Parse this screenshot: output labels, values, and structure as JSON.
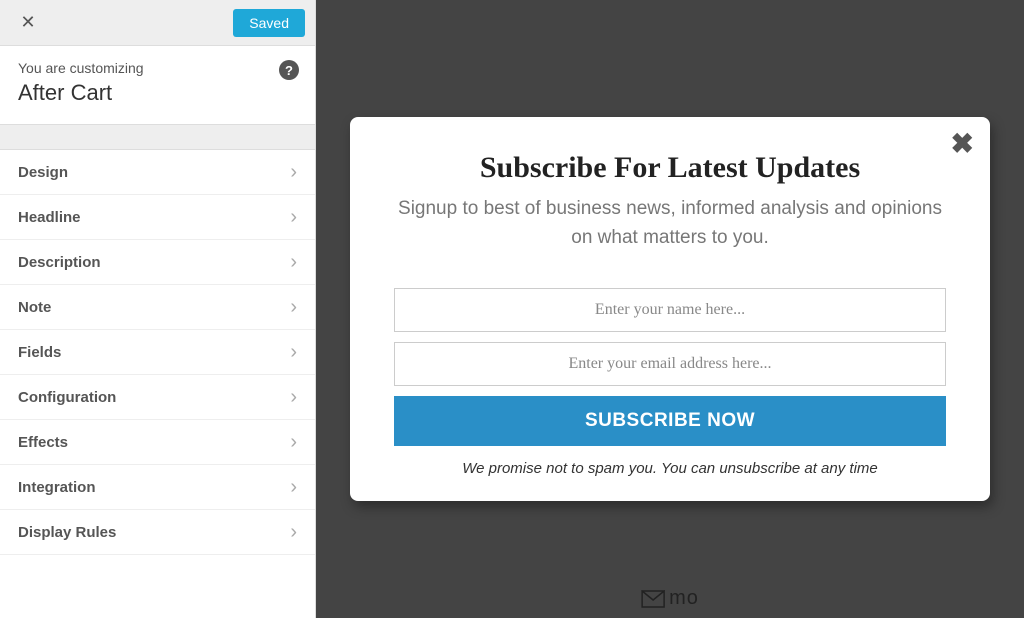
{
  "sidebar": {
    "saved_label": "Saved",
    "customizing_label": "You are customizing",
    "customizing_title": "After Cart",
    "items": [
      {
        "label": "Design"
      },
      {
        "label": "Headline"
      },
      {
        "label": "Description"
      },
      {
        "label": "Note"
      },
      {
        "label": "Fields"
      },
      {
        "label": "Configuration"
      },
      {
        "label": "Effects"
      },
      {
        "label": "Integration"
      },
      {
        "label": "Display Rules"
      }
    ]
  },
  "popup": {
    "title": "Subscribe For Latest Updates",
    "description": "Signup to best of business news, informed analysis and opinions on what matters to you.",
    "name_placeholder": "Enter your name here...",
    "email_placeholder": "Enter your email address here...",
    "button_label": "SUBSCRIBE NOW",
    "note": "We promise not to spam you. You can unsubscribe at any time"
  },
  "footer_brand": "mo"
}
